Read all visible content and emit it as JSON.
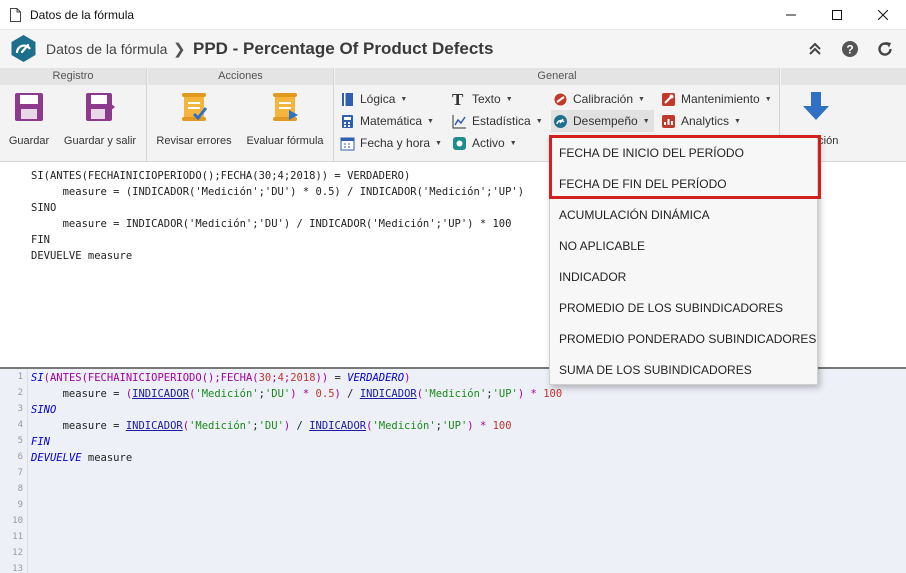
{
  "window": {
    "title": "Datos de la fórmula",
    "controls": [
      "minimize",
      "maximize",
      "close"
    ]
  },
  "header": {
    "breadcrumb": "Datos de la fórmula",
    "separator": "❯",
    "title": "PPD - Percentage Of Product Defects",
    "icons": [
      "collapse-icon",
      "help-icon",
      "refresh-icon"
    ]
  },
  "ribbon": {
    "groups": {
      "registro": "Registro",
      "acciones": "Acciones",
      "general": "General"
    },
    "buttons": {
      "save": "Guardar",
      "save_exit": "Guardar y salir",
      "review_errors": "Revisar errores",
      "evaluate": "Evaluar fórmula",
      "insert_partial": "Inserción"
    },
    "menus": {
      "logica": "Lógica",
      "matematica": "Matemática",
      "fecha_hora": "Fecha y hora",
      "texto": "Texto",
      "estadistica": "Estadística",
      "activo": "Activo",
      "calibracion": "Calibración",
      "desempeno": "Desempeño",
      "mantenimiento": "Mantenimiento",
      "analytics": "Analytics"
    },
    "colors": {
      "accent_blue": "#2f6fc4",
      "accent_red": "#c0392b",
      "teal": "#1e8c8a"
    }
  },
  "editor": {
    "plain_lines": [
      "SI(ANTES(FECHAINICIOPERIODO();FECHA(30;4;2018)) = VERDADERO)",
      "     measure = (INDICADOR('Medición';'DU') * 0.5) / INDICADOR('Medición';'UP')",
      "SINO",
      "     measure = INDICADOR('Medición';'DU') / INDICADOR('Medición';'UP') * 100",
      "FIN",
      "DEVUELVE measure"
    ],
    "line_numbers": [
      "1",
      "2",
      "3",
      "4",
      "5",
      "6",
      "7",
      "8",
      "9",
      "10",
      "11",
      "12",
      "13"
    ]
  },
  "dropdown": {
    "items": [
      "FECHA DE INICIO DEL PERÍODO",
      "FECHA DE FIN DEL PERÍODO",
      "ACUMULACIÓN DINÁMICA",
      "NO APLICABLE",
      "INDICADOR",
      "PROMEDIO DE LOS SUBINDICADORES",
      "PROMEDIO PONDERADO SUBINDICADORES",
      "SUMA DE LOS SUBINDICADORES"
    ],
    "highlight_color": "#d21f1f"
  }
}
